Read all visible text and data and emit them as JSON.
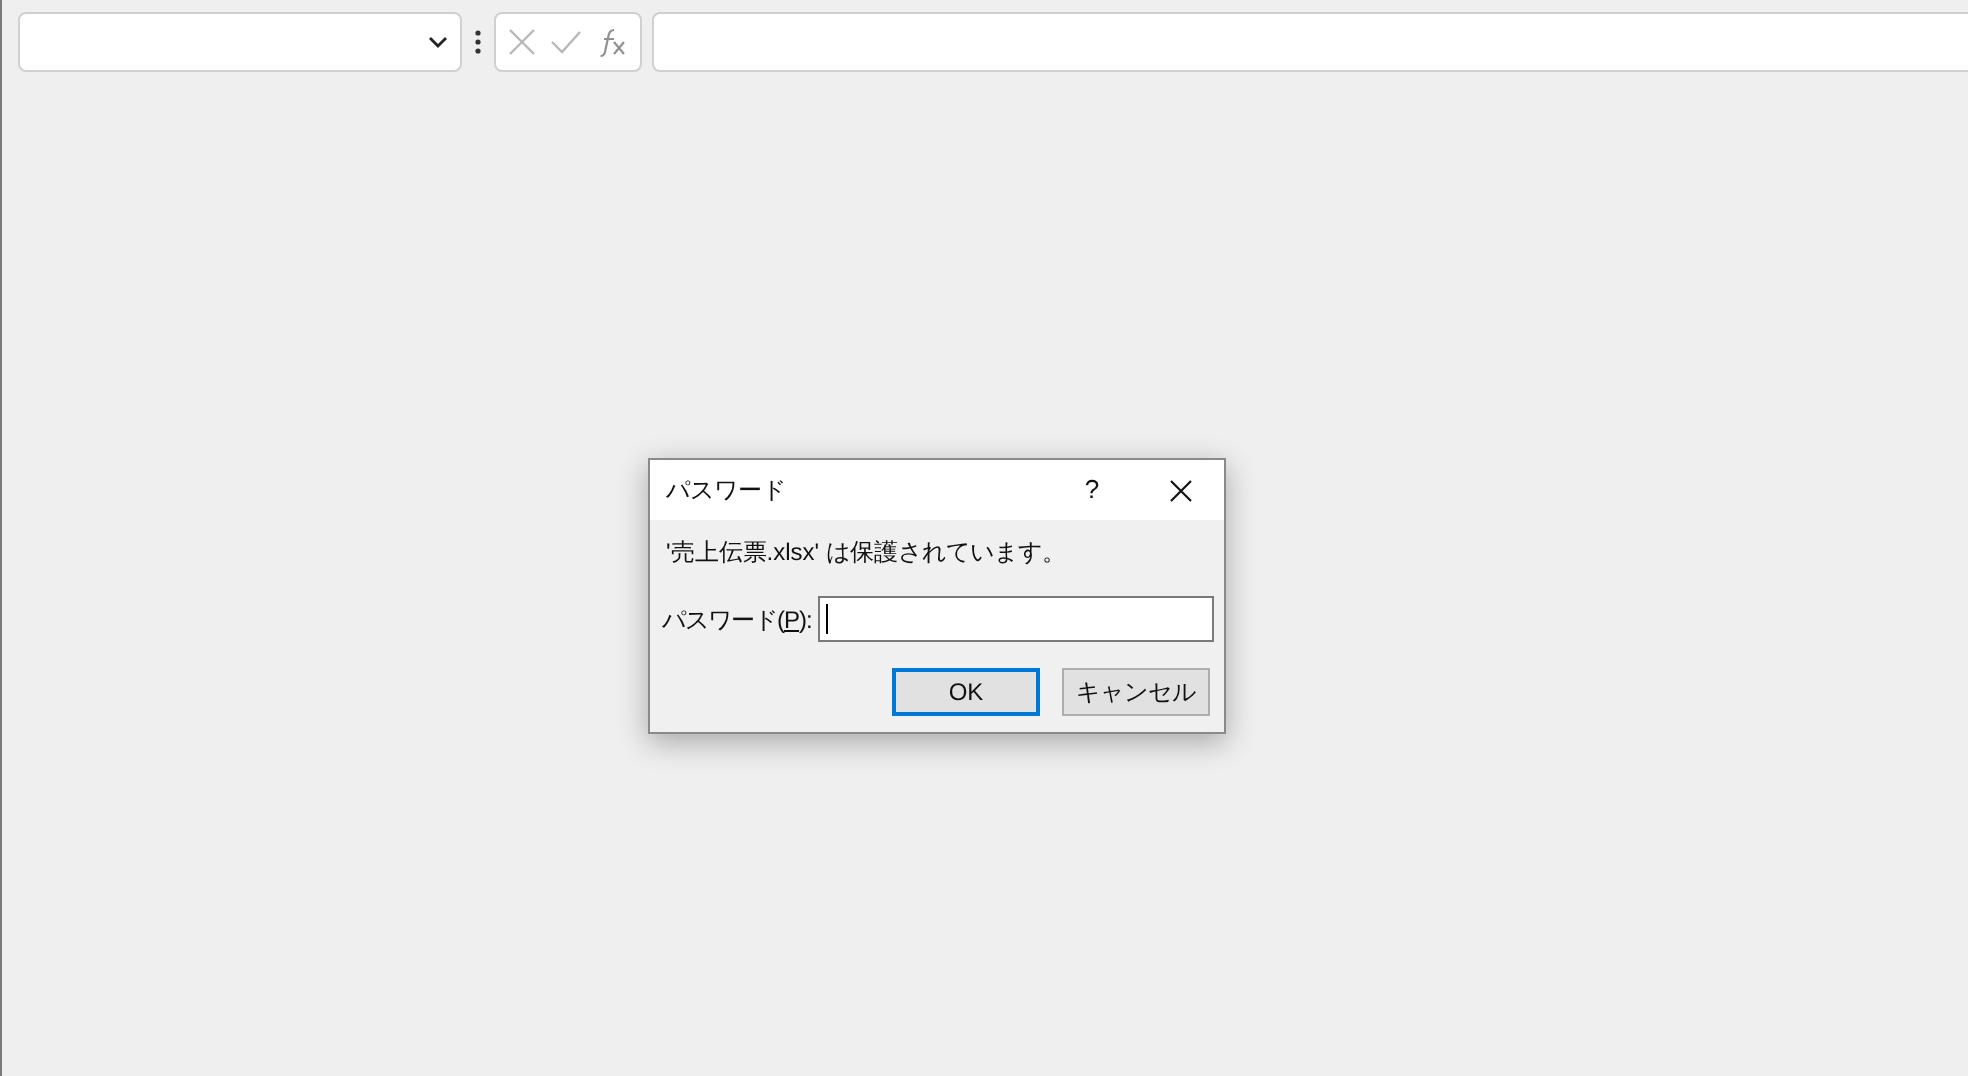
{
  "dialog": {
    "title": "パスワード",
    "help": "?",
    "message": "'売上伝票.xlsx' は保護されています。",
    "password": {
      "label_before": "パスワード(",
      "access_key": "P",
      "label_after": "):"
    },
    "buttons": [
      {
        "label": "OK",
        "default": true
      },
      {
        "label": "キャンセル",
        "default": false
      }
    ]
  }
}
